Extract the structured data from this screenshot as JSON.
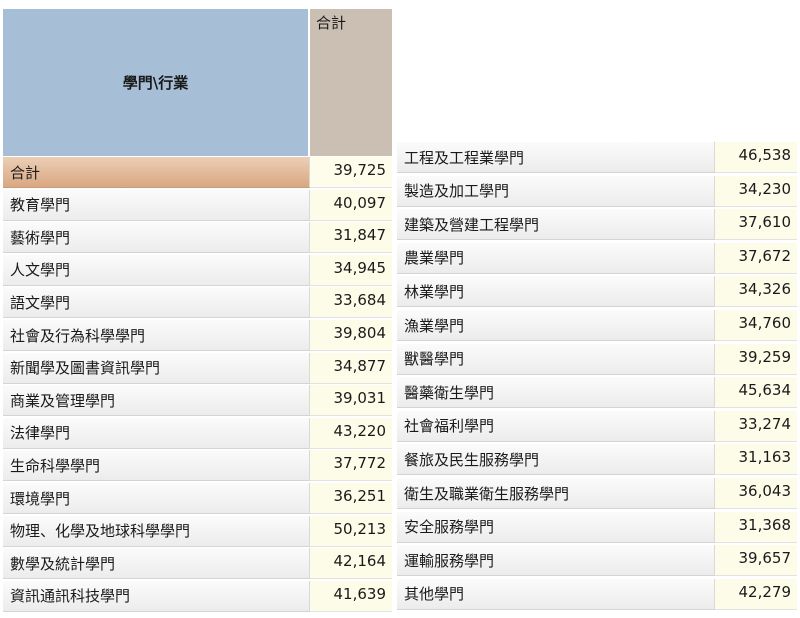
{
  "header": {
    "label": "學門\\行業",
    "total": "合計"
  },
  "left_rows": [
    {
      "label": "合計",
      "value": "39,725"
    },
    {
      "label": "教育學門",
      "value": "40,097"
    },
    {
      "label": "藝術學門",
      "value": "31,847"
    },
    {
      "label": "人文學門",
      "value": "34,945"
    },
    {
      "label": "語文學門",
      "value": "33,684"
    },
    {
      "label": "社會及行為科學學門",
      "value": "39,804"
    },
    {
      "label": "新聞學及圖書資訊學門",
      "value": "34,877"
    },
    {
      "label": "商業及管理學門",
      "value": "39,031"
    },
    {
      "label": "法律學門",
      "value": "43,220"
    },
    {
      "label": "生命科學學門",
      "value": "37,772"
    },
    {
      "label": "環境學門",
      "value": "36,251"
    },
    {
      "label": "物理、化學及地球科學學門",
      "value": "50,213"
    },
    {
      "label": "數學及統計學門",
      "value": "42,164"
    },
    {
      "label": "資訊通訊科技學門",
      "value": "41,639"
    }
  ],
  "right_rows": [
    {
      "label": "工程及工程業學門",
      "value": "46,538"
    },
    {
      "label": "製造及加工學門",
      "value": "34,230"
    },
    {
      "label": "建築及營建工程學門",
      "value": "37,610"
    },
    {
      "label": "農業學門",
      "value": "37,672"
    },
    {
      "label": "林業學門",
      "value": "34,326"
    },
    {
      "label": "漁業學門",
      "value": "34,760"
    },
    {
      "label": "獸醫學門",
      "value": "39,259"
    },
    {
      "label": "醫藥衛生學門",
      "value": "45,634"
    },
    {
      "label": "社會福利學門",
      "value": "33,274"
    },
    {
      "label": "餐旅及民生服務學門",
      "value": "31,163"
    },
    {
      "label": "衛生及職業衛生服務學門",
      "value": "36,043"
    },
    {
      "label": "安全服務學門",
      "value": "31,368"
    },
    {
      "label": "運輸服務學門",
      "value": "39,657"
    },
    {
      "label": "其他學門",
      "value": "42,279"
    }
  ]
}
